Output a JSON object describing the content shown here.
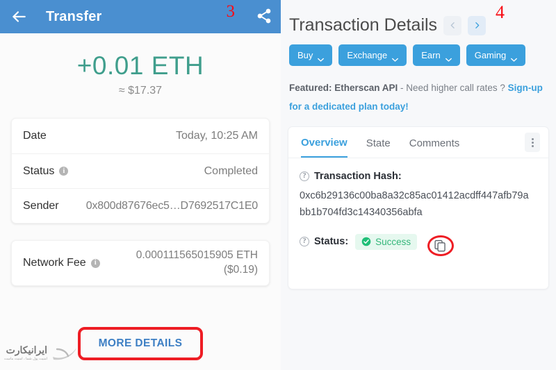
{
  "left": {
    "appbar": {
      "title": "Transfer",
      "back_icon": "arrow-left-icon",
      "share_icon": "share-icon",
      "marker": "3"
    },
    "amount": {
      "value": "+0.01 ETH",
      "fiat": "≈ $17.37"
    },
    "details": [
      {
        "label": "Date",
        "value": "Today, 10:25 AM",
        "info": false
      },
      {
        "label": "Status",
        "value": "Completed",
        "info": true
      },
      {
        "label": "Sender",
        "value": "0x800d87676ec5…D7692517C1E0",
        "info": false
      }
    ],
    "fee": {
      "label": "Network Fee",
      "value_eth": "0.000111565015905 ETH",
      "value_usd": "($0.19)"
    },
    "more_details_label": "MORE DETAILS",
    "watermark": {
      "title": "ایرانیکارت",
      "subtitle": "امنیت پول شما ، امنیت ماست"
    }
  },
  "right": {
    "marker": "4",
    "page_title": "Transaction Details",
    "nav": {
      "prev_icon": "chevron-left-icon",
      "next_icon": "chevron-right-icon"
    },
    "pills": [
      {
        "label": "Buy"
      },
      {
        "label": "Exchange"
      },
      {
        "label": "Earn"
      },
      {
        "label": "Gaming"
      }
    ],
    "featured": {
      "prefix": "Featured: Etherscan API",
      "middle": " - Need higher call rates ? ",
      "link": "Sign-up for a dedicated plan today!"
    },
    "tabs": [
      {
        "label": "Overview",
        "active": true
      },
      {
        "label": "State",
        "active": false
      },
      {
        "label": "Comments",
        "active": false
      }
    ],
    "kebab_icon": "more-vertical-icon",
    "tx_hash": {
      "label": "Transaction Hash:",
      "line1": "0xc6b29136c00ba8a32c85ac01412acdff447afb79ab",
      "line2": "b1b704fd3c14340356abfa",
      "copy_icon": "copy-icon"
    },
    "status": {
      "label": "Status:",
      "value": "Success"
    }
  },
  "colors": {
    "appbar_blue": "#4a8fd0",
    "amount_green": "#3f9e8c",
    "link_blue": "#3ba0dd",
    "highlight_red": "#ee1d24",
    "success_green": "#34b67a"
  }
}
